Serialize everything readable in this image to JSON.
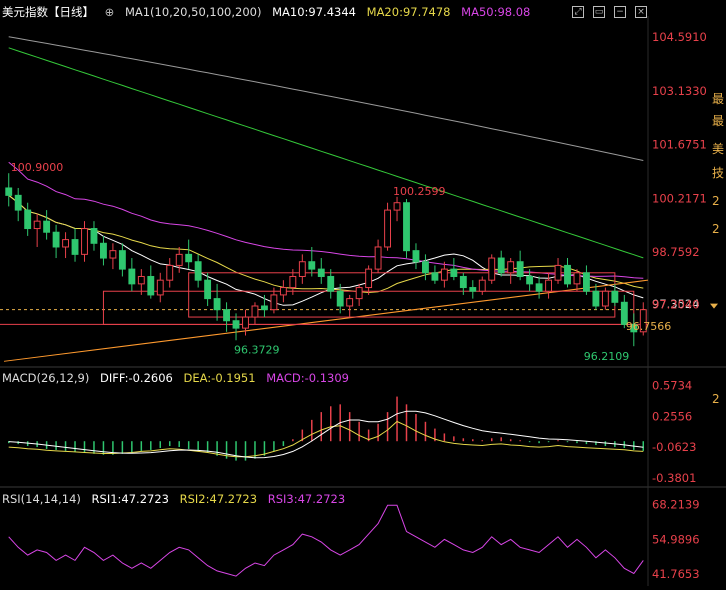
{
  "symbol": "美元指数【日线】",
  "ma_header": {
    "label": "MA1(10,20,50,100,200)",
    "ma10": "MA10:97.4344",
    "ma20": "MA20:97.7478",
    "ma50": "MA50:98.08"
  },
  "price_axis_ticks": [
    "104.5910",
    "103.1330",
    "101.6751",
    "100.2171",
    "98.7592",
    "97.3524"
  ],
  "annotations": {
    "high_left": "100.9000",
    "high_mid": "100.2599",
    "low_left": "96.3729",
    "low_right": "96.2109",
    "partial_price": "97.2040",
    "right_marker": "96.7566"
  },
  "macd_header": {
    "label": "MACD(26,12,9)",
    "diff": "DIFF:-0.2606",
    "dea": "DEA:-0.1951",
    "macd": "MACD:-0.1309"
  },
  "macd_axis_ticks": [
    "0.5734",
    "0.2556",
    "-0.0623",
    "-0.3801"
  ],
  "rsi_header": {
    "label": "RSI(14,14,14)",
    "rsi1": "RSI1:47.2723",
    "rsi2": "RSI2:47.2723",
    "rsi3": "RSI3:47.2723"
  },
  "rsi_axis_ticks": [
    "68.2139",
    "54.9896",
    "41.7653"
  ],
  "side_text": [
    "最",
    "最",
    "美",
    "技",
    "2",
    "2",
    "2"
  ],
  "colors": {
    "up": "#e8414b",
    "down": "#2fc76f",
    "ma10": "#ffffff",
    "ma20": "#e6d84a",
    "ma50": "#d846e6",
    "ma100": "#35c93a",
    "ma200": "#9a9a9a",
    "trend": "#ff9a2e",
    "axis": "#c8c8c8",
    "dea": "#e6d84a",
    "diff": "#ffffff"
  },
  "chart_data": [
    {
      "type": "candlestick",
      "title": "美元指数【日线】",
      "ylim": [
        95.7,
        105.0
      ],
      "annotations": [
        "100.9000 (high)",
        "100.2599 (high)",
        "96.3729 (low)",
        "96.2109 (low)"
      ],
      "candles": [
        [
          100.5,
          100.9,
          100.0,
          100.3
        ],
        [
          100.3,
          100.5,
          99.6,
          99.9
        ],
        [
          99.9,
          100.1,
          99.2,
          99.4
        ],
        [
          99.4,
          99.8,
          98.9,
          99.6
        ],
        [
          99.6,
          99.9,
          99.1,
          99.3
        ],
        [
          99.3,
          99.5,
          98.6,
          98.9
        ],
        [
          98.9,
          99.3,
          98.6,
          99.1
        ],
        [
          99.1,
          99.4,
          98.5,
          98.7
        ],
        [
          98.7,
          99.6,
          98.5,
          99.4
        ],
        [
          99.4,
          99.6,
          98.8,
          99.0
        ],
        [
          99.0,
          99.2,
          98.4,
          98.6
        ],
        [
          98.6,
          99.0,
          98.3,
          98.8
        ],
        [
          98.8,
          99.0,
          98.1,
          98.3
        ],
        [
          98.3,
          98.6,
          97.7,
          97.9
        ],
        [
          97.9,
          98.3,
          97.6,
          98.1
        ],
        [
          98.1,
          98.4,
          97.5,
          97.6
        ],
        [
          97.6,
          98.2,
          97.4,
          98.0
        ],
        [
          98.0,
          98.6,
          97.8,
          98.4
        ],
        [
          98.4,
          98.9,
          98.2,
          98.7
        ],
        [
          98.7,
          99.1,
          98.3,
          98.5
        ],
        [
          98.5,
          98.7,
          97.8,
          98.0
        ],
        [
          98.0,
          98.2,
          97.3,
          97.5
        ],
        [
          97.5,
          97.9,
          96.9,
          97.2
        ],
        [
          97.2,
          97.4,
          96.6,
          96.9
        ],
        [
          96.9,
          97.1,
          96.37,
          96.7
        ],
        [
          96.7,
          97.2,
          96.5,
          97.0
        ],
        [
          97.0,
          97.4,
          96.8,
          97.3
        ],
        [
          97.3,
          97.6,
          97.0,
          97.2
        ],
        [
          97.2,
          97.8,
          97.1,
          97.6
        ],
        [
          97.6,
          98.0,
          97.4,
          97.8
        ],
        [
          97.8,
          98.3,
          97.6,
          98.1
        ],
        [
          98.1,
          98.7,
          97.9,
          98.5
        ],
        [
          98.5,
          98.9,
          98.1,
          98.3
        ],
        [
          98.3,
          98.6,
          97.9,
          98.1
        ],
        [
          98.1,
          98.3,
          97.5,
          97.7
        ],
        [
          97.7,
          97.9,
          97.1,
          97.3
        ],
        [
          97.3,
          97.6,
          97.0,
          97.5
        ],
        [
          97.5,
          97.9,
          97.3,
          97.8
        ],
        [
          97.8,
          98.4,
          97.6,
          98.3
        ],
        [
          98.3,
          99.1,
          98.2,
          98.9
        ],
        [
          98.9,
          100.1,
          98.8,
          99.9
        ],
        [
          99.9,
          100.26,
          99.6,
          100.1
        ],
        [
          100.1,
          100.2,
          98.6,
          98.8
        ],
        [
          98.8,
          99.0,
          98.3,
          98.5
        ],
        [
          98.5,
          98.7,
          98.0,
          98.2
        ],
        [
          98.2,
          98.4,
          97.9,
          98.0
        ],
        [
          98.0,
          98.5,
          97.8,
          98.3
        ],
        [
          98.3,
          98.6,
          98.0,
          98.1
        ],
        [
          98.1,
          98.2,
          97.6,
          97.8
        ],
        [
          97.8,
          98.0,
          97.5,
          97.7
        ],
        [
          97.7,
          98.1,
          97.6,
          98.0
        ],
        [
          98.0,
          98.7,
          97.9,
          98.6
        ],
        [
          98.6,
          98.8,
          98.1,
          98.2
        ],
        [
          98.2,
          98.6,
          97.9,
          98.5
        ],
        [
          98.5,
          98.8,
          98.0,
          98.1
        ],
        [
          98.1,
          98.3,
          97.7,
          97.9
        ],
        [
          97.9,
          98.1,
          97.5,
          97.7
        ],
        [
          97.7,
          98.2,
          97.5,
          98.0
        ],
        [
          98.0,
          98.6,
          97.9,
          98.4
        ],
        [
          98.4,
          98.6,
          97.8,
          97.9
        ],
        [
          97.9,
          98.3,
          97.7,
          98.2
        ],
        [
          98.2,
          98.4,
          97.6,
          97.7
        ],
        [
          97.7,
          97.9,
          97.2,
          97.3
        ],
        [
          97.3,
          97.8,
          97.2,
          97.7
        ],
        [
          97.7,
          97.9,
          97.3,
          97.4
        ],
        [
          97.4,
          97.6,
          96.7,
          96.8
        ],
        [
          96.8,
          97.1,
          96.21,
          96.6
        ],
        [
          96.6,
          97.4,
          96.5,
          97.2
        ]
      ]
    },
    {
      "type": "bar",
      "title": "MACD(26,12,9)",
      "ylim": [
        -0.4,
        0.6
      ],
      "values": [
        -0.02,
        -0.03,
        -0.05,
        -0.06,
        -0.08,
        -0.09,
        -0.1,
        -0.11,
        -0.12,
        -0.13,
        -0.14,
        -0.14,
        -0.13,
        -0.12,
        -0.1,
        -0.09,
        -0.07,
        -0.05,
        -0.06,
        -0.08,
        -0.1,
        -0.12,
        -0.15,
        -0.18,
        -0.2,
        -0.2,
        -0.18,
        -0.15,
        -0.1,
        -0.05,
        0.02,
        0.12,
        0.22,
        0.3,
        0.36,
        0.38,
        0.3,
        0.2,
        0.12,
        0.18,
        0.3,
        0.46,
        0.38,
        0.28,
        0.2,
        0.13,
        0.08,
        0.05,
        0.03,
        0.02,
        0.01,
        0.03,
        0.04,
        0.02,
        0.01,
        -0.01,
        -0.02,
        -0.01,
        0.01,
        -0.01,
        -0.02,
        -0.03,
        -0.04,
        -0.05,
        -0.06,
        -0.07,
        -0.09,
        -0.1
      ]
    },
    {
      "type": "line",
      "title": "RSI(14,14,14)",
      "ylim": [
        38,
        70
      ],
      "values": [
        56,
        52,
        49,
        51,
        50,
        47,
        49,
        47,
        52,
        50,
        47,
        49,
        46,
        44,
        46,
        44,
        47,
        50,
        52,
        51,
        48,
        45,
        43,
        42,
        41,
        44,
        46,
        45,
        49,
        51,
        53,
        57,
        56,
        54,
        51,
        49,
        51,
        53,
        57,
        61,
        68,
        68,
        58,
        56,
        54,
        52,
        55,
        53,
        51,
        50,
        52,
        56,
        53,
        55,
        52,
        51,
        50,
        53,
        56,
        52,
        55,
        52,
        48,
        51,
        48,
        44,
        42,
        47
      ]
    }
  ]
}
